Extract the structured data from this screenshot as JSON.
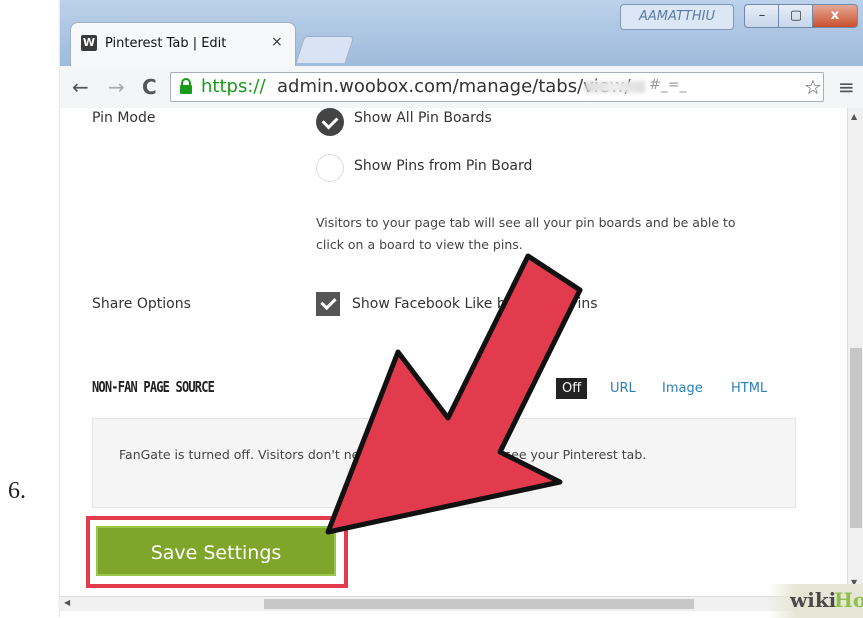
{
  "step": {
    "number": "6."
  },
  "browser": {
    "tab_title": "Pinterest Tab | Edit",
    "tab_favicon": "W",
    "tab_close": "×",
    "user_badge": "AAMATTHIU",
    "window_buttons": {
      "minimize": "–",
      "maximize": "▢",
      "close": "x"
    },
    "url_scheme": "https://",
    "url_rest": "admin.woobox.com/manage/tabs/view/",
    "url_tail": "#_=_",
    "icons": {
      "back": "←",
      "forward": "→",
      "reload": "C",
      "star": "☆",
      "menu": "≡",
      "lock": "lock-icon"
    }
  },
  "settings": {
    "pin_mode": {
      "label": "Pin Mode",
      "options": [
        {
          "label": "Show All Pin Boards",
          "checked": true
        },
        {
          "label": "Show Pins from Pin Board",
          "checked": false
        }
      ],
      "description_line1": "Visitors to your page tab will see all your pin boards and be able to",
      "description_line2": "click on a board to view the pins."
    },
    "share_options": {
      "label": "Share Options",
      "checkbox_label": "Show Facebook Like button on Pins",
      "checked": true
    },
    "non_fan": {
      "title": "NON-FAN PAGE SOURCE",
      "segments": [
        "Off",
        "URL",
        "Image",
        "HTML"
      ],
      "active": "Off",
      "fangate_text": "FanGate is turned off. Visitors don't need to like your page to see your Pinterest tab."
    },
    "save_label": "Save Settings"
  },
  "colors": {
    "save_green": "#7fa62b",
    "arrow_red": "#e23b4d",
    "link_blue": "#2a7fc1"
  },
  "watermark": {
    "wiki": "wiki",
    "how": "How"
  }
}
